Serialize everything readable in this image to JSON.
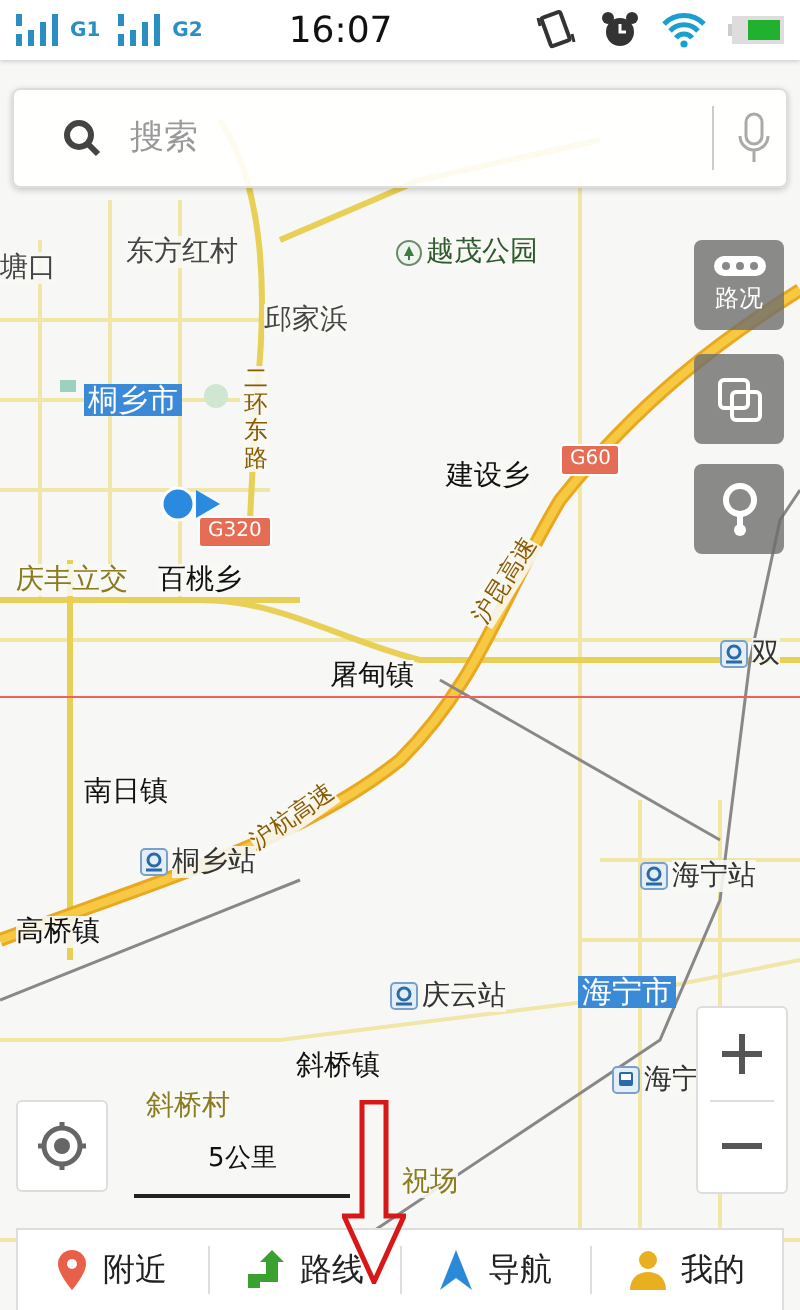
{
  "status_bar": {
    "time": "16:07",
    "sim_labels": [
      "G1",
      "G2"
    ]
  },
  "search": {
    "placeholder": "搜索"
  },
  "map": {
    "labels": [
      {
        "kind": "place",
        "text": "塘口"
      },
      {
        "kind": "place",
        "text": "东方红村"
      },
      {
        "kind": "park",
        "text": "越茂公园"
      },
      {
        "kind": "place",
        "text": "邱家浜"
      },
      {
        "kind": "city",
        "text": "桐乡市"
      },
      {
        "kind": "road",
        "text": "二环东路"
      },
      {
        "kind": "town",
        "text": "建设乡"
      },
      {
        "kind": "shield",
        "text": "G60"
      },
      {
        "kind": "shield",
        "text": "G320"
      },
      {
        "kind": "village",
        "text": "庆丰立交"
      },
      {
        "kind": "town",
        "text": "百桃乡"
      },
      {
        "kind": "road",
        "text": "沪昆高速"
      },
      {
        "kind": "town",
        "text": "屠甸镇"
      },
      {
        "kind": "station",
        "text": "双"
      },
      {
        "kind": "town",
        "text": "南日镇"
      },
      {
        "kind": "road",
        "text": "沪杭高速"
      },
      {
        "kind": "station",
        "text": "桐乡站"
      },
      {
        "kind": "station",
        "text": "海宁站"
      },
      {
        "kind": "town",
        "text": "高桥镇"
      },
      {
        "kind": "station",
        "text": "庆云站"
      },
      {
        "kind": "city",
        "text": "海宁市"
      },
      {
        "kind": "town",
        "text": "斜桥镇"
      },
      {
        "kind": "bus",
        "text": "海宁"
      },
      {
        "kind": "village",
        "text": "斜桥村"
      },
      {
        "kind": "village",
        "text": "祝场"
      }
    ],
    "traffic_button": "路况",
    "scale": "5公里"
  },
  "nav": [
    {
      "kind": "nearby",
      "label": "附近"
    },
    {
      "kind": "route",
      "label": "路线"
    },
    {
      "kind": "navigate",
      "label": "导航"
    },
    {
      "kind": "mine",
      "label": "我的"
    }
  ]
}
